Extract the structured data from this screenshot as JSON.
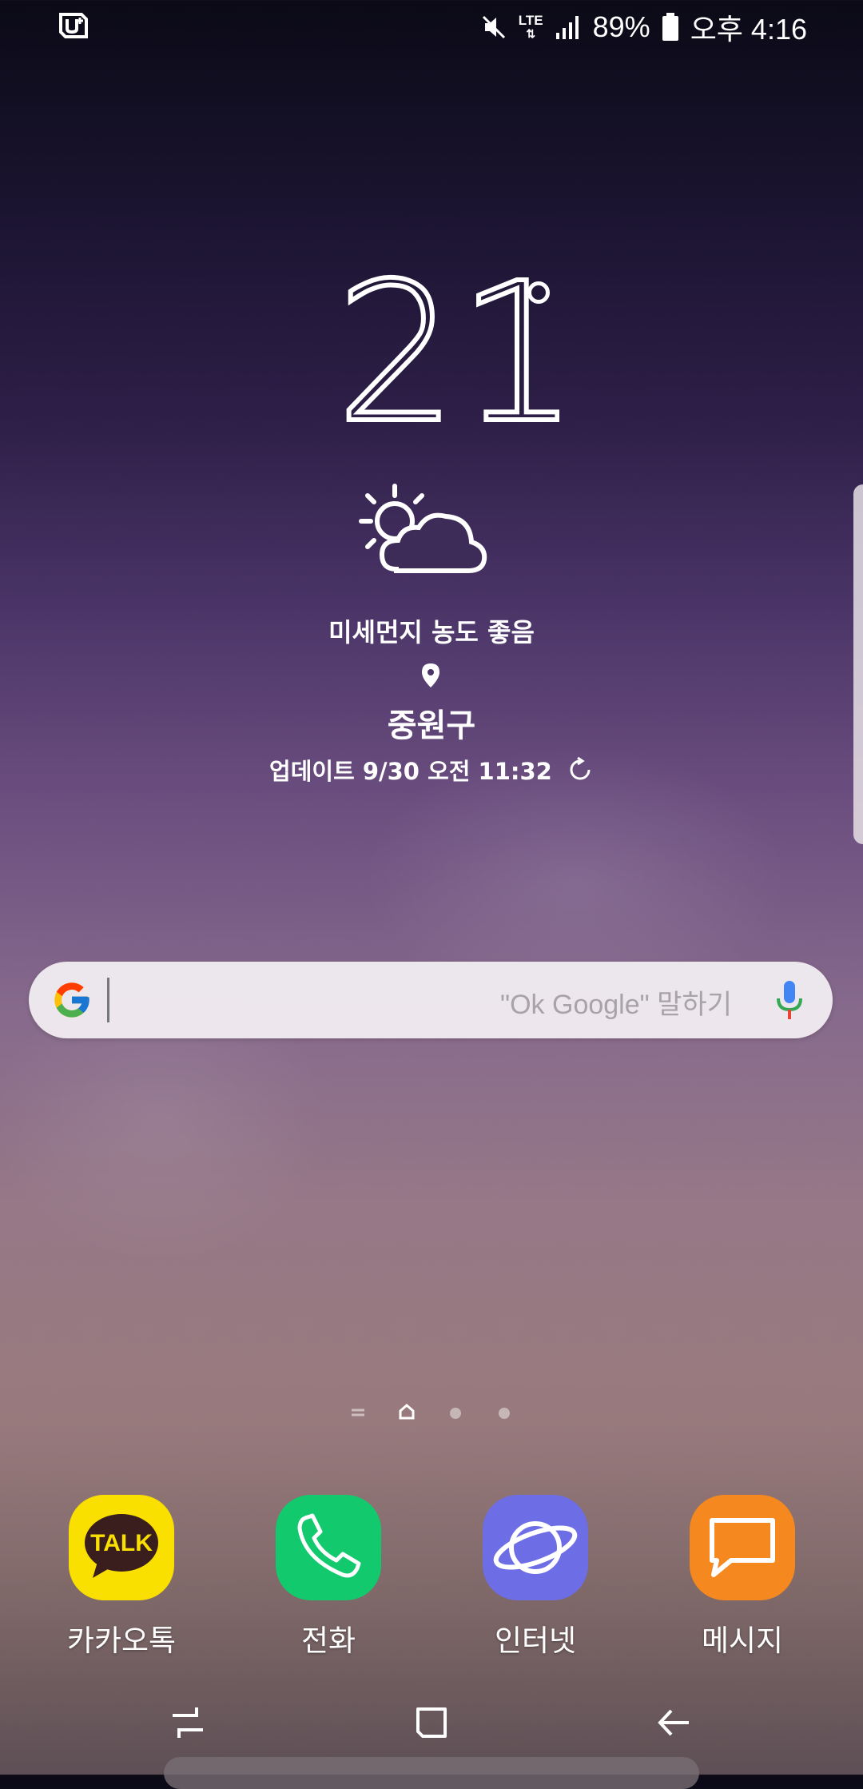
{
  "status_bar": {
    "battery": "89%",
    "time": "오후 4:16",
    "network": "LTE"
  },
  "weather": {
    "temperature": "21",
    "air_quality": "미세먼지 농도 좋음",
    "location": "중원구",
    "updated": "업데이트 9/30 오전 11:32"
  },
  "search_bar": {
    "placeholder": "\"Ok Google\" 말하기"
  },
  "dock": {
    "apps": [
      {
        "label": "카카오톡",
        "icon": "kakaotalk-icon",
        "icon_text": "TALK",
        "color": "#f9e000"
      },
      {
        "label": "전화",
        "icon": "phone-icon",
        "color": "#12c96e"
      },
      {
        "label": "인터넷",
        "icon": "internet-icon",
        "color": "#6d6de6"
      },
      {
        "label": "메시지",
        "icon": "message-icon",
        "color": "#f5881f"
      }
    ]
  }
}
